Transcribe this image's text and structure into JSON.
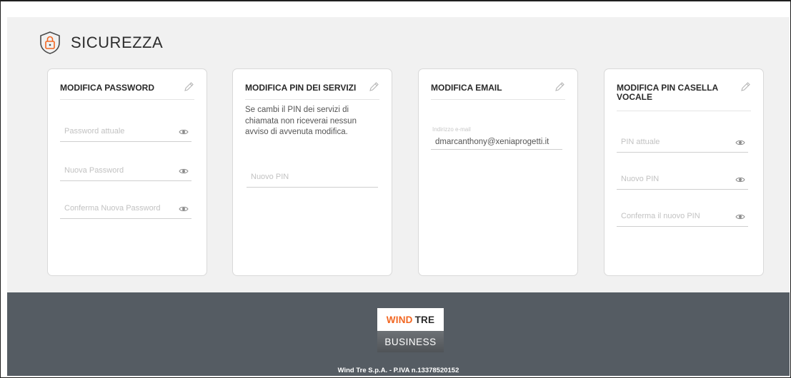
{
  "section": {
    "title": "SICUREZZA",
    "icon": "shield-lock-icon"
  },
  "cards": {
    "password": {
      "title": "MODIFICA PASSWORD",
      "fields": [
        {
          "placeholder": "Password attuale"
        },
        {
          "placeholder": "Nuova Password"
        },
        {
          "placeholder": "Conferma Nuova Password"
        }
      ]
    },
    "pin_servizi": {
      "title": "MODIFICA PIN DEI SERVIZI",
      "description": "Se cambi il PIN dei servizi di chiamata non riceverai nessun avviso di avvenuta modifica.",
      "fields": [
        {
          "placeholder": "Nuovo PIN"
        }
      ]
    },
    "email": {
      "title": "MODIFICA EMAIL",
      "label": "Indirizzo e-mail",
      "value": "dmarcanthony@xeniaprogetti.it"
    },
    "pin_casella": {
      "title": "MODIFICA PIN CASELLA VOCALE",
      "fields": [
        {
          "placeholder": "PIN attuale"
        },
        {
          "placeholder": "Nuovo PIN"
        },
        {
          "placeholder": "Conferma il nuovo PIN"
        }
      ]
    }
  },
  "footer": {
    "logo_wind": "WIND",
    "logo_tre": "TRE",
    "logo_business": "BUSINESS",
    "copyright": "Wind Tre S.p.A. - P.IVA n.13378520152"
  },
  "colors": {
    "accent": "#f26722",
    "footer_bg": "#555c63",
    "main_bg": "#f1f1f1"
  }
}
